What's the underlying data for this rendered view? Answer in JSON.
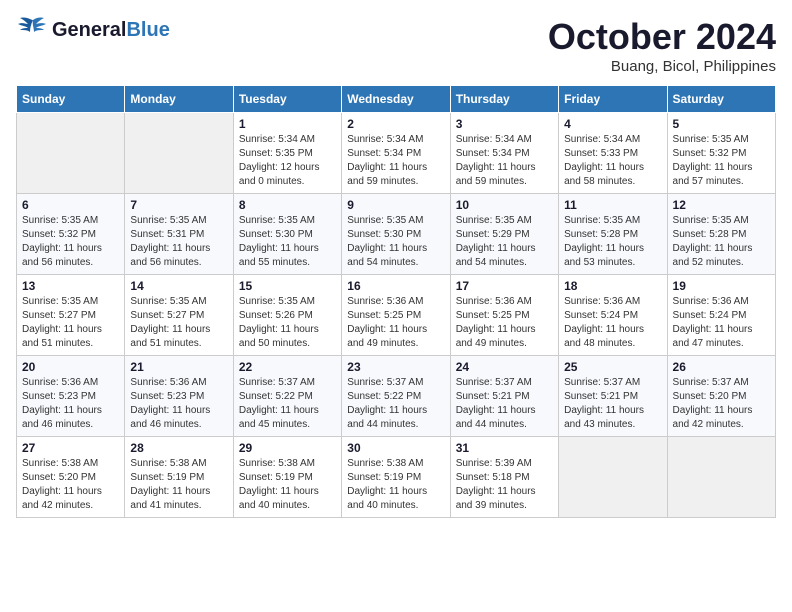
{
  "header": {
    "logo_general": "General",
    "logo_blue": "Blue",
    "month_title": "October 2024",
    "location": "Buang, Bicol, Philippines"
  },
  "days_of_week": [
    "Sunday",
    "Monday",
    "Tuesday",
    "Wednesday",
    "Thursday",
    "Friday",
    "Saturday"
  ],
  "weeks": [
    [
      {
        "num": "",
        "empty": true
      },
      {
        "num": "",
        "empty": true
      },
      {
        "num": "1",
        "sunrise": "Sunrise: 5:34 AM",
        "sunset": "Sunset: 5:35 PM",
        "daylight": "Daylight: 12 hours and 0 minutes."
      },
      {
        "num": "2",
        "sunrise": "Sunrise: 5:34 AM",
        "sunset": "Sunset: 5:34 PM",
        "daylight": "Daylight: 11 hours and 59 minutes."
      },
      {
        "num": "3",
        "sunrise": "Sunrise: 5:34 AM",
        "sunset": "Sunset: 5:34 PM",
        "daylight": "Daylight: 11 hours and 59 minutes."
      },
      {
        "num": "4",
        "sunrise": "Sunrise: 5:34 AM",
        "sunset": "Sunset: 5:33 PM",
        "daylight": "Daylight: 11 hours and 58 minutes."
      },
      {
        "num": "5",
        "sunrise": "Sunrise: 5:35 AM",
        "sunset": "Sunset: 5:32 PM",
        "daylight": "Daylight: 11 hours and 57 minutes."
      }
    ],
    [
      {
        "num": "6",
        "sunrise": "Sunrise: 5:35 AM",
        "sunset": "Sunset: 5:32 PM",
        "daylight": "Daylight: 11 hours and 56 minutes."
      },
      {
        "num": "7",
        "sunrise": "Sunrise: 5:35 AM",
        "sunset": "Sunset: 5:31 PM",
        "daylight": "Daylight: 11 hours and 56 minutes."
      },
      {
        "num": "8",
        "sunrise": "Sunrise: 5:35 AM",
        "sunset": "Sunset: 5:30 PM",
        "daylight": "Daylight: 11 hours and 55 minutes."
      },
      {
        "num": "9",
        "sunrise": "Sunrise: 5:35 AM",
        "sunset": "Sunset: 5:30 PM",
        "daylight": "Daylight: 11 hours and 54 minutes."
      },
      {
        "num": "10",
        "sunrise": "Sunrise: 5:35 AM",
        "sunset": "Sunset: 5:29 PM",
        "daylight": "Daylight: 11 hours and 54 minutes."
      },
      {
        "num": "11",
        "sunrise": "Sunrise: 5:35 AM",
        "sunset": "Sunset: 5:28 PM",
        "daylight": "Daylight: 11 hours and 53 minutes."
      },
      {
        "num": "12",
        "sunrise": "Sunrise: 5:35 AM",
        "sunset": "Sunset: 5:28 PM",
        "daylight": "Daylight: 11 hours and 52 minutes."
      }
    ],
    [
      {
        "num": "13",
        "sunrise": "Sunrise: 5:35 AM",
        "sunset": "Sunset: 5:27 PM",
        "daylight": "Daylight: 11 hours and 51 minutes."
      },
      {
        "num": "14",
        "sunrise": "Sunrise: 5:35 AM",
        "sunset": "Sunset: 5:27 PM",
        "daylight": "Daylight: 11 hours and 51 minutes."
      },
      {
        "num": "15",
        "sunrise": "Sunrise: 5:35 AM",
        "sunset": "Sunset: 5:26 PM",
        "daylight": "Daylight: 11 hours and 50 minutes."
      },
      {
        "num": "16",
        "sunrise": "Sunrise: 5:36 AM",
        "sunset": "Sunset: 5:25 PM",
        "daylight": "Daylight: 11 hours and 49 minutes."
      },
      {
        "num": "17",
        "sunrise": "Sunrise: 5:36 AM",
        "sunset": "Sunset: 5:25 PM",
        "daylight": "Daylight: 11 hours and 49 minutes."
      },
      {
        "num": "18",
        "sunrise": "Sunrise: 5:36 AM",
        "sunset": "Sunset: 5:24 PM",
        "daylight": "Daylight: 11 hours and 48 minutes."
      },
      {
        "num": "19",
        "sunrise": "Sunrise: 5:36 AM",
        "sunset": "Sunset: 5:24 PM",
        "daylight": "Daylight: 11 hours and 47 minutes."
      }
    ],
    [
      {
        "num": "20",
        "sunrise": "Sunrise: 5:36 AM",
        "sunset": "Sunset: 5:23 PM",
        "daylight": "Daylight: 11 hours and 46 minutes."
      },
      {
        "num": "21",
        "sunrise": "Sunrise: 5:36 AM",
        "sunset": "Sunset: 5:23 PM",
        "daylight": "Daylight: 11 hours and 46 minutes."
      },
      {
        "num": "22",
        "sunrise": "Sunrise: 5:37 AM",
        "sunset": "Sunset: 5:22 PM",
        "daylight": "Daylight: 11 hours and 45 minutes."
      },
      {
        "num": "23",
        "sunrise": "Sunrise: 5:37 AM",
        "sunset": "Sunset: 5:22 PM",
        "daylight": "Daylight: 11 hours and 44 minutes."
      },
      {
        "num": "24",
        "sunrise": "Sunrise: 5:37 AM",
        "sunset": "Sunset: 5:21 PM",
        "daylight": "Daylight: 11 hours and 44 minutes."
      },
      {
        "num": "25",
        "sunrise": "Sunrise: 5:37 AM",
        "sunset": "Sunset: 5:21 PM",
        "daylight": "Daylight: 11 hours and 43 minutes."
      },
      {
        "num": "26",
        "sunrise": "Sunrise: 5:37 AM",
        "sunset": "Sunset: 5:20 PM",
        "daylight": "Daylight: 11 hours and 42 minutes."
      }
    ],
    [
      {
        "num": "27",
        "sunrise": "Sunrise: 5:38 AM",
        "sunset": "Sunset: 5:20 PM",
        "daylight": "Daylight: 11 hours and 42 minutes."
      },
      {
        "num": "28",
        "sunrise": "Sunrise: 5:38 AM",
        "sunset": "Sunset: 5:19 PM",
        "daylight": "Daylight: 11 hours and 41 minutes."
      },
      {
        "num": "29",
        "sunrise": "Sunrise: 5:38 AM",
        "sunset": "Sunset: 5:19 PM",
        "daylight": "Daylight: 11 hours and 40 minutes."
      },
      {
        "num": "30",
        "sunrise": "Sunrise: 5:38 AM",
        "sunset": "Sunset: 5:19 PM",
        "daylight": "Daylight: 11 hours and 40 minutes."
      },
      {
        "num": "31",
        "sunrise": "Sunrise: 5:39 AM",
        "sunset": "Sunset: 5:18 PM",
        "daylight": "Daylight: 11 hours and 39 minutes."
      },
      {
        "num": "",
        "empty": true
      },
      {
        "num": "",
        "empty": true
      }
    ]
  ]
}
